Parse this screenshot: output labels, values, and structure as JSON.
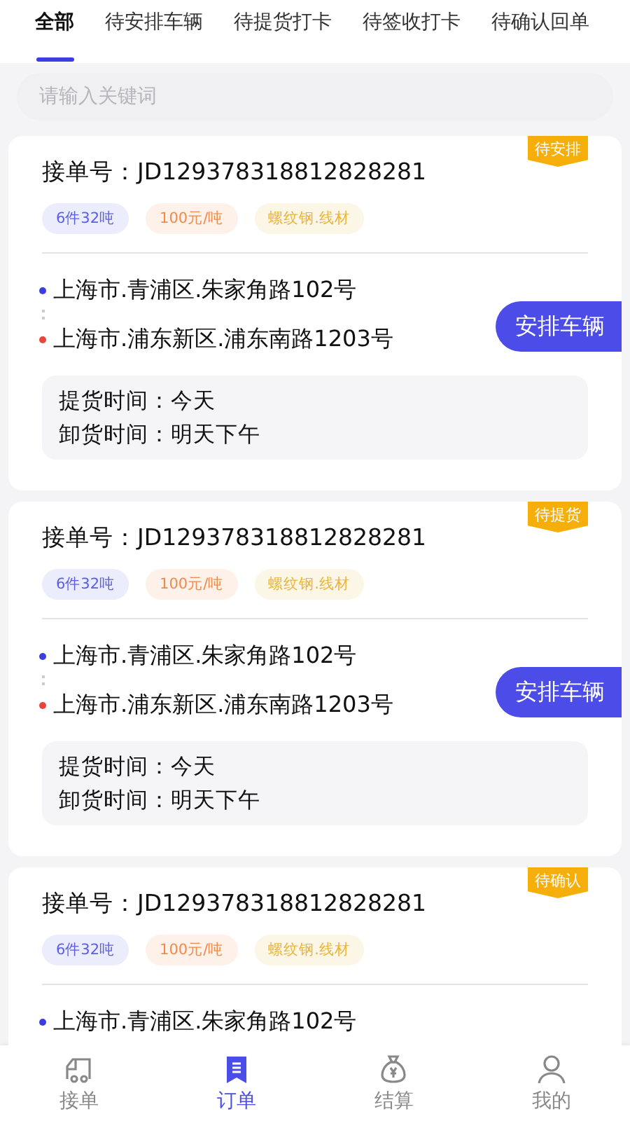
{
  "tabs": [
    {
      "label": "全部",
      "selected": true
    },
    {
      "label": "待安排车辆",
      "selected": false
    },
    {
      "label": "待提货打卡",
      "selected": false
    },
    {
      "label": "待签收打卡",
      "selected": false
    },
    {
      "label": "待确认回单",
      "selected": false
    }
  ],
  "search": {
    "placeholder": "请输入关键词"
  },
  "orders": [
    {
      "status": "待安排",
      "order_label": "接单号：",
      "order_no": "JD129378318812828281",
      "tags": [
        {
          "text": "6件32吨",
          "color": "#5b5fe8"
        },
        {
          "text": "100元/吨",
          "color": "#f08a4b"
        },
        {
          "text": "螺纹钢.线材",
          "color": "#e9b43a"
        }
      ],
      "from": "上海市.青浦区.朱家角路102号",
      "to": "上海市.浦东新区.浦东南路1203号",
      "action": "安排车辆",
      "pickup_time": "提货时间：今天",
      "unload_time": "卸货时间：明天下午"
    },
    {
      "status": "待提货",
      "order_label": "接单号：",
      "order_no": "JD129378318812828281",
      "tags": [
        {
          "text": "6件32吨",
          "color": "#5b5fe8"
        },
        {
          "text": "100元/吨",
          "color": "#f08a4b"
        },
        {
          "text": "螺纹钢.线材",
          "color": "#e9b43a"
        }
      ],
      "from": "上海市.青浦区.朱家角路102号",
      "to": "上海市.浦东新区.浦东南路1203号",
      "action": "安排车辆",
      "pickup_time": "提货时间：今天",
      "unload_time": "卸货时间：明天下午"
    },
    {
      "status": "待确认",
      "order_label": "接单号：",
      "order_no": "JD129378318812828281",
      "tags": [
        {
          "text": "6件32吨",
          "color": "#5b5fe8"
        },
        {
          "text": "100元/吨",
          "color": "#f08a4b"
        },
        {
          "text": "螺纹钢.线材",
          "color": "#e9b43a"
        }
      ],
      "from": "上海市.青浦区.朱家角路102号"
    }
  ],
  "nav": [
    {
      "label": "接单",
      "kind": "truck",
      "selected": false
    },
    {
      "label": "订单",
      "kind": "order",
      "selected": true
    },
    {
      "label": "结算",
      "kind": "money",
      "selected": false
    },
    {
      "label": "我的",
      "kind": "user",
      "selected": false
    }
  ]
}
